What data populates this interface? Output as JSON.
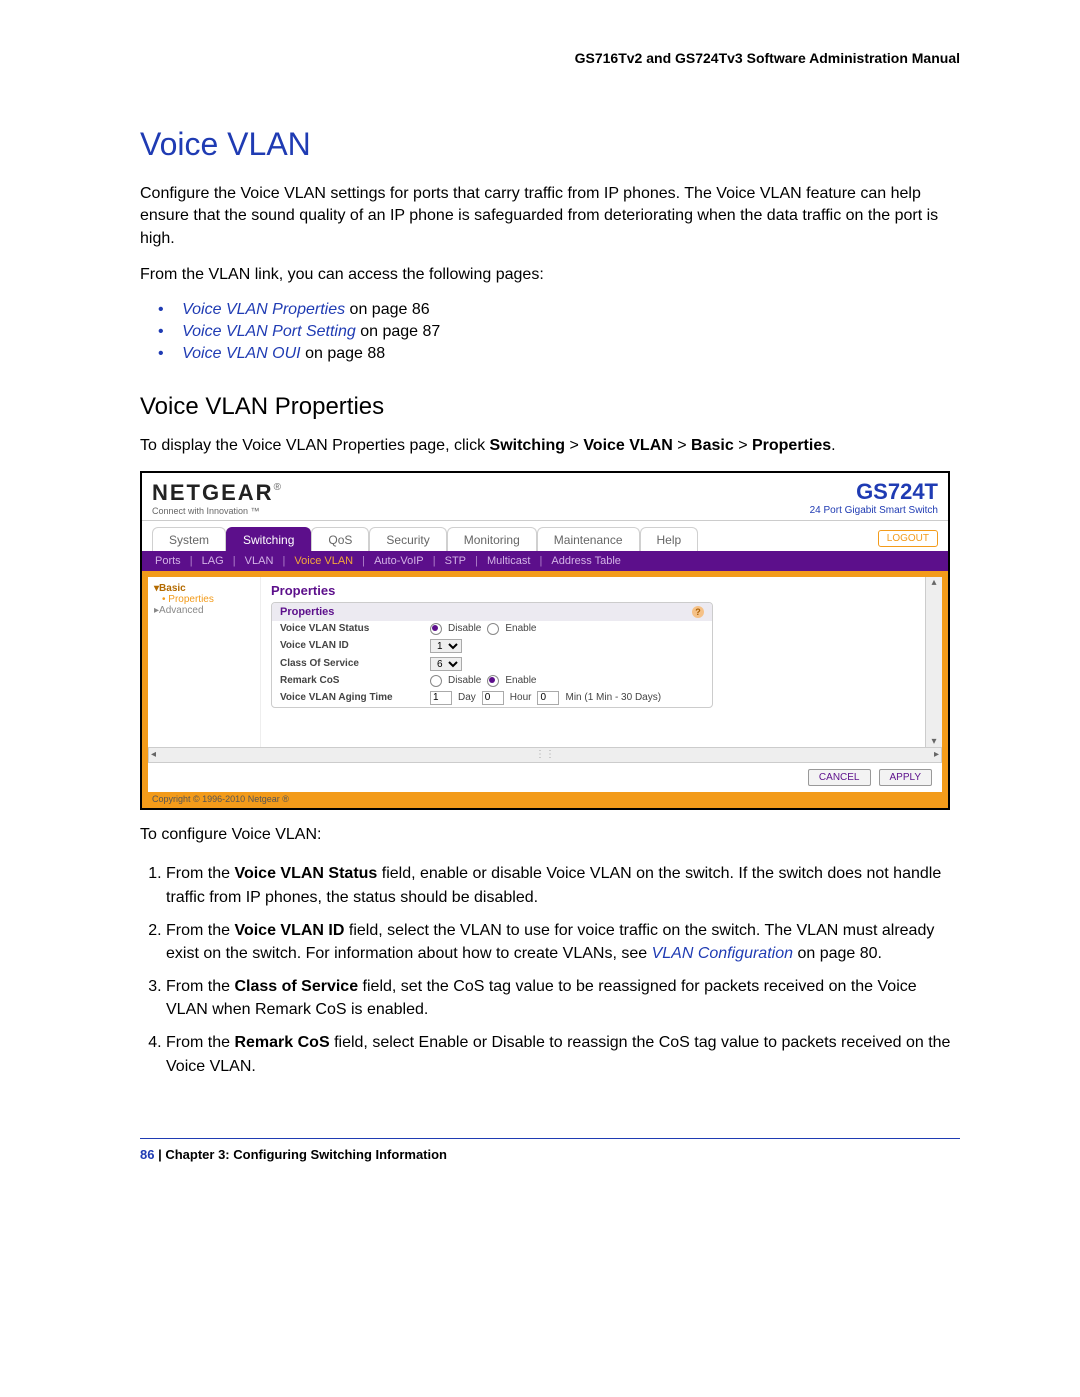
{
  "header": {
    "manual_title": "GS716Tv2 and GS724Tv3 Software Administration Manual"
  },
  "h1": "Voice VLAN",
  "intro1": "Configure the Voice VLAN settings for ports that carry traffic from IP phones. The Voice VLAN feature can help ensure that the sound quality of an IP phone is safeguarded from deteriorating when the data traffic on the port is high.",
  "intro2": "From the VLAN link, you can access the following pages:",
  "links": {
    "l1_link": "Voice VLAN Properties",
    "l1_tail": " on page 86",
    "l2_link": "Voice VLAN Port Setting",
    "l2_tail": " on page 87",
    "l3_link": "Voice VLAN OUI",
    "l3_tail": " on page 88"
  },
  "h2": "Voice VLAN Properties",
  "path_text": {
    "pre": "To display the Voice VLAN Properties page, click ",
    "switching": "Switching",
    "vvlan": "Voice VLAN",
    "basic": "Basic",
    "properties": "Properties",
    "period": "."
  },
  "screenshot": {
    "brand": {
      "name": "NETGEAR",
      "reg": "®",
      "tag": "Connect with Innovation ™"
    },
    "model": {
      "name": "GS724T",
      "desc": "24 Port Gigabit Smart Switch"
    },
    "tabs": [
      "System",
      "Switching",
      "QoS",
      "Security",
      "Monitoring",
      "Maintenance",
      "Help"
    ],
    "active_tab_index": 1,
    "logout": "LOGOUT",
    "subnav": [
      "Ports",
      "LAG",
      "VLAN",
      "Voice VLAN",
      "Auto-VoIP",
      "STP",
      "Multicast",
      "Address Table"
    ],
    "subnav_active_index": 3,
    "sidebar": {
      "basic": "Basic",
      "properties": "Properties",
      "advanced": "Advanced"
    },
    "panel_title": "Properties",
    "box_title": "Properties",
    "fields": {
      "status_label": "Voice VLAN Status",
      "status_disable": "Disable",
      "status_enable": "Enable",
      "id_label": "Voice VLAN ID",
      "id_value": "1",
      "cos_label": "Class Of Service",
      "cos_value": "6",
      "remark_label": "Remark CoS",
      "remark_disable": "Disable",
      "remark_enable": "Enable",
      "aging_label": "Voice VLAN Aging Time",
      "aging_day_val": "1",
      "aging_day": "Day",
      "aging_hour_val": "0",
      "aging_hour": "Hour",
      "aging_min_val": "0",
      "aging_min": "Min (1 Min - 30 Days)"
    },
    "buttons": {
      "cancel": "CANCEL",
      "apply": "APPLY"
    },
    "copyright": "Copyright © 1996-2010 Netgear ®"
  },
  "post_ss": "To configure Voice VLAN:",
  "steps": {
    "s1a": "From the ",
    "s1b": "Voice VLAN Status",
    "s1c": " field, enable or disable Voice VLAN on the switch. If the switch does not handle traffic from IP phones, the status should be disabled.",
    "s2a": "From the ",
    "s2b": "Voice VLAN ID",
    "s2c": " field, select the VLAN to use for voice traffic on the switch. The VLAN must already exist on the switch. For information about how to create VLANs, see ",
    "s2link": "VLAN Configuration",
    "s2d": " on page 80.",
    "s3a": "From the ",
    "s3b": "Class of Service",
    "s3c": " field, set the CoS tag value to be reassigned for packets received on the Voice VLAN when Remark CoS is enabled.",
    "s4a": "From the ",
    "s4b": "Remark CoS",
    "s4c": " field, select Enable or Disable to reassign the CoS tag value to packets received on the Voice VLAN."
  },
  "footer": {
    "page": "86",
    "sep": "   |   ",
    "chapter": "Chapter 3:  Configuring Switching Information"
  }
}
